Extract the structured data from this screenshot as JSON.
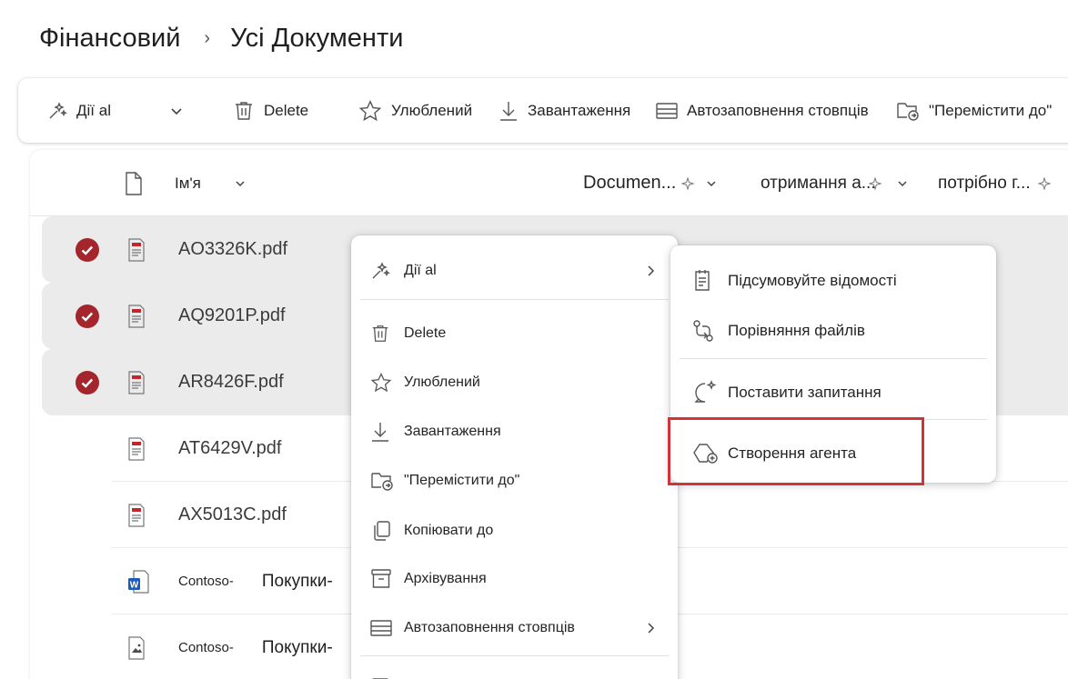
{
  "breadcrumb": {
    "site": "Фінансовий",
    "separator": "›",
    "library": "Усі Документи"
  },
  "toolbar": {
    "ai_actions": "Дії al",
    "delete": "Delete",
    "favorite": "Улюблений",
    "download": "Завантаження",
    "autofill": "Автозаповнення стовпців",
    "move_to": "\"Перемістити до\""
  },
  "columns": {
    "name": "Ім'я",
    "document": "Documen...",
    "received": "отримання а...",
    "needed": "потрібно г..."
  },
  "files": [
    {
      "name": "AO3326K.pdf",
      "type": "pdf",
      "selected": true
    },
    {
      "name": "AQ9201P.pdf",
      "type": "pdf",
      "selected": true
    },
    {
      "name": "AR8426F.pdf",
      "type": "pdf",
      "selected": true
    },
    {
      "name": "AT6429V.pdf",
      "type": "pdf",
      "selected": false
    },
    {
      "name": "AX5013C.pdf",
      "type": "pdf",
      "selected": false
    },
    {
      "name_prefix": "Contoso-",
      "name_suffix": "Покупки-",
      "type": "word",
      "selected": false
    },
    {
      "name_prefix": "Contoso-",
      "name_suffix": "Покупки-",
      "type": "image",
      "selected": false
    }
  ],
  "context_menu": {
    "ai_actions": "Дії al",
    "delete": "Delete",
    "favorite": "Улюблений",
    "download": "Завантаження",
    "move_to": "\"Перемістити до\"",
    "copy_to": "Копіювати до",
    "archive": "Архівування",
    "autofill": "Автозаповнення стовпців"
  },
  "submenu": {
    "summarize": "Підсумовуйте відомості",
    "compare": "Порівняння файлів",
    "ask": "Поставити запитання",
    "create_agent": "Створення агента"
  },
  "colors": {
    "accent_check": "#a4262c",
    "highlight_border": "#d13438",
    "selected_row": "#ebebeb"
  }
}
